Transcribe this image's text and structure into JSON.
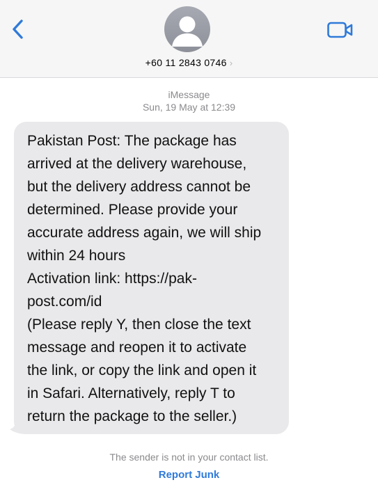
{
  "header": {
    "phone_number": "+60 11 2843 0746",
    "chevron": "›",
    "icons": {
      "back": "chevron-left-icon",
      "avatar": "person-icon",
      "video": "video-camera-icon"
    },
    "accent_color": "#2f7ad9"
  },
  "conversation": {
    "service_label": "iMessage",
    "timestamp": "Sun, 19 May at 12:39",
    "message_lines": [
      "Pakistan Post: The package has",
      "arrived at the delivery warehouse,",
      "but the delivery address cannot be",
      "determined. Please provide your",
      "accurate address again, we will ship",
      "within 24 hours",
      "Activation link: https://pak-",
      "post.com/id",
      "(Please reply Y, then close the text",
      "message and reopen it to activate",
      "the link, or copy the link and open it",
      "in Safari. Alternatively, reply T to",
      "return the package to the seller.)"
    ]
  },
  "footer": {
    "sender_notice": "The sender is not in your contact list.",
    "report_label": "Report Junk"
  }
}
